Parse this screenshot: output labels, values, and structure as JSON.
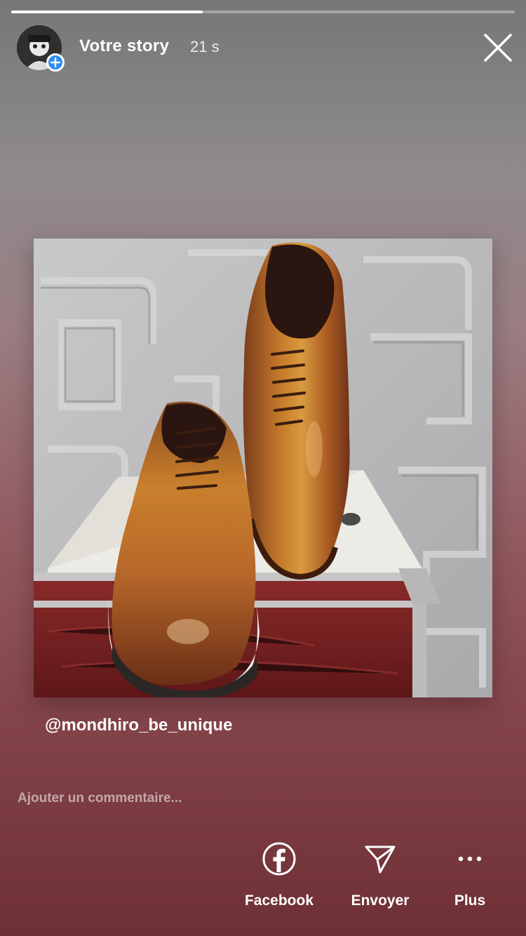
{
  "story": {
    "progress": 0.38,
    "title": "Votre story",
    "elapsed": "21 s",
    "mention": "@mondhiro_be_unique"
  },
  "comment": {
    "placeholder": "Ajouter un commentaire..."
  },
  "actions": {
    "facebook_label": "Facebook",
    "send_label": "Envoyer",
    "more_label": "Plus"
  },
  "colors": {
    "accent": "#2d8cf0"
  }
}
